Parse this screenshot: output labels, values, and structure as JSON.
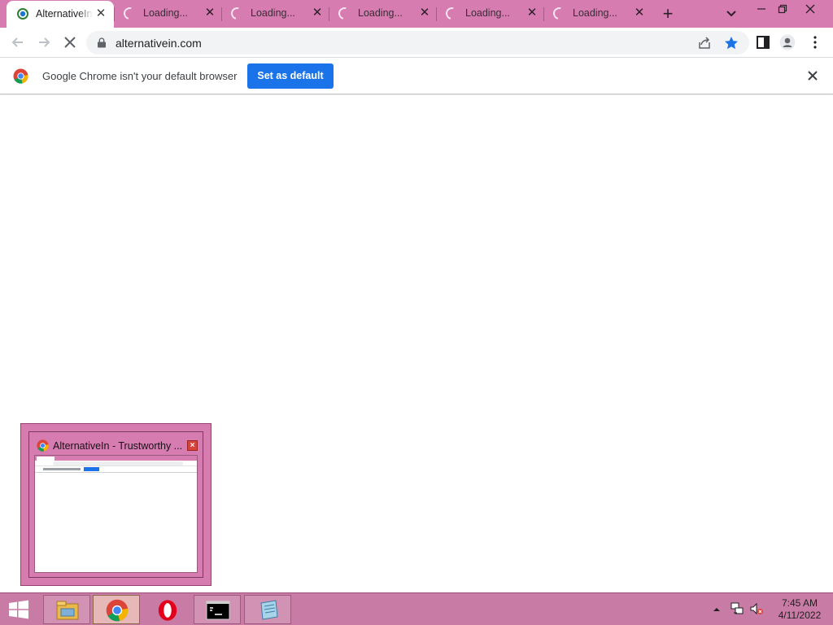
{
  "browser": {
    "tabs": [
      {
        "title": "AlternativeIn",
        "state": "active"
      },
      {
        "title": "Loading...",
        "state": "loading"
      },
      {
        "title": "Loading...",
        "state": "loading"
      },
      {
        "title": "Loading...",
        "state": "loading"
      },
      {
        "title": "Loading...",
        "state": "loading"
      },
      {
        "title": "Loading...",
        "state": "loading"
      }
    ],
    "tab_close_glyph": "✕",
    "new_tab_glyph": "+",
    "address_bar": {
      "url": "alternativein.com"
    },
    "infobar": {
      "message": "Google Chrome isn't your default browser",
      "button_label": "Set as default"
    },
    "colors": {
      "frame": "#d77cb0",
      "accent_blue": "#1a73e8"
    }
  },
  "thumbnail_preview": {
    "title": "AlternativeIn - Trustworthy ...",
    "close_glyph": "×"
  },
  "taskbar": {
    "apps": [
      "windows-explorer",
      "google-chrome",
      "opera",
      "command-prompt",
      "notepad"
    ],
    "active_app": "google-chrome",
    "clock": {
      "time": "7:45 AM",
      "date": "4/11/2022"
    }
  }
}
